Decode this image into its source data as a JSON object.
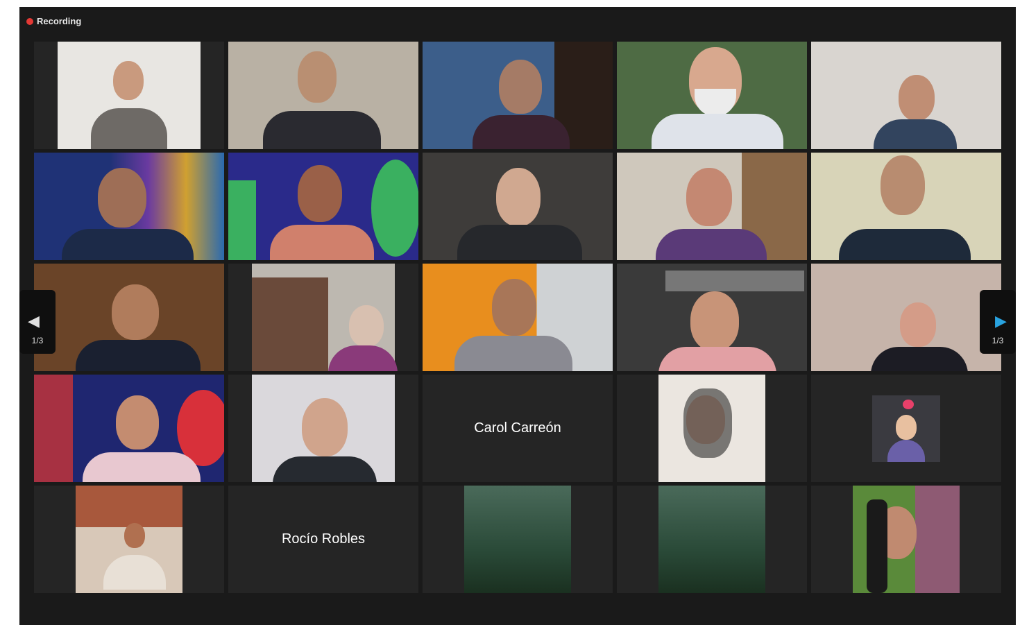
{
  "recording_label": "Recording",
  "page_indicator_left": "1/3",
  "page_indicator_right": "1/3",
  "participants": {
    "carol": "Carol Carreón",
    "rocio": "Rocío Robles"
  },
  "colors": {
    "active_speaker_border": "#c8d84a",
    "recording_dot": "#e53935",
    "nav_arrow_right": "#29a3e0"
  },
  "icons": {
    "prev": "chevron-left-icon",
    "next": "chevron-right-icon",
    "recording": "recording-dot-icon"
  }
}
